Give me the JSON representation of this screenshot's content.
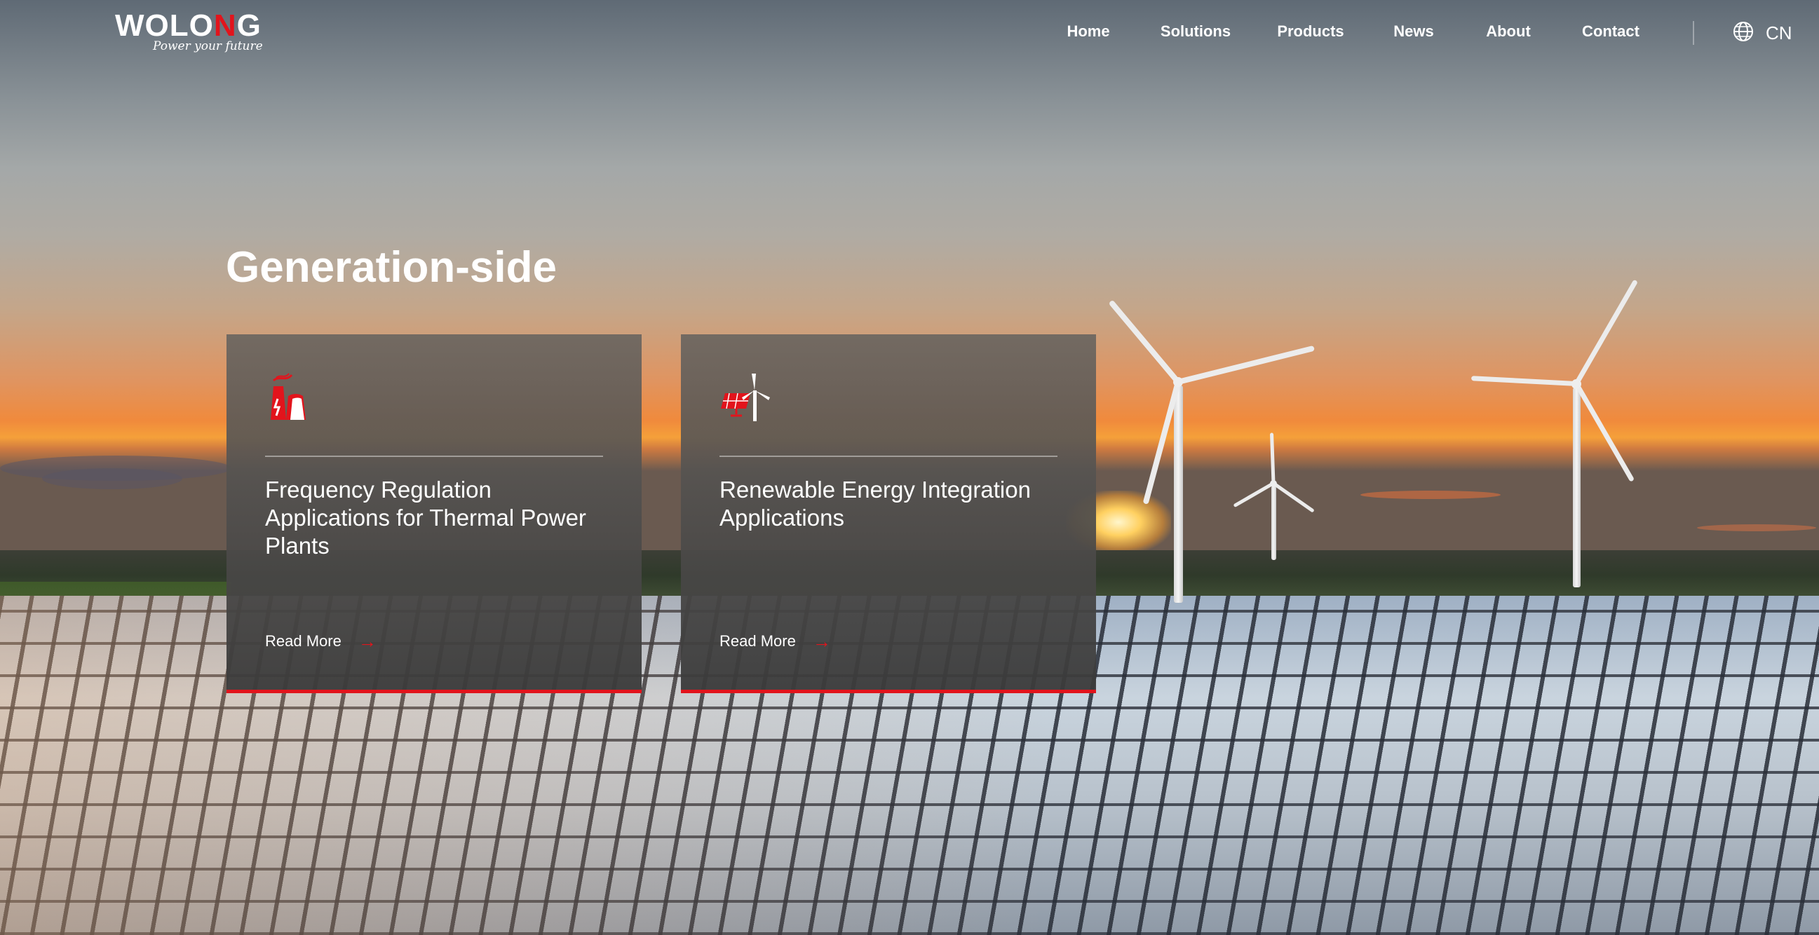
{
  "brand": {
    "name_prefix": "WOLO",
    "name_accent": "N",
    "name_suffix": "G",
    "tagline": "Power your future",
    "accent_color": "#e2141c"
  },
  "nav": {
    "items": [
      {
        "label": "Home"
      },
      {
        "label": "Solutions"
      },
      {
        "label": "Products"
      },
      {
        "label": "News"
      },
      {
        "label": "About"
      },
      {
        "label": "Contact"
      }
    ],
    "language": {
      "label": "CN",
      "icon": "globe-icon"
    }
  },
  "section": {
    "title": "Generation-side",
    "cards": [
      {
        "icon": "thermal-power-plant-icon",
        "title": "Frequency Regulation Applications for Thermal Power Plants",
        "link_label": "Read More",
        "link_icon": "arrow-right-icon"
      },
      {
        "icon": "solar-wind-icon",
        "title": "Renewable Energy Integration Applications",
        "link_label": "Read More",
        "link_icon": "arrow-right-icon"
      }
    ]
  }
}
